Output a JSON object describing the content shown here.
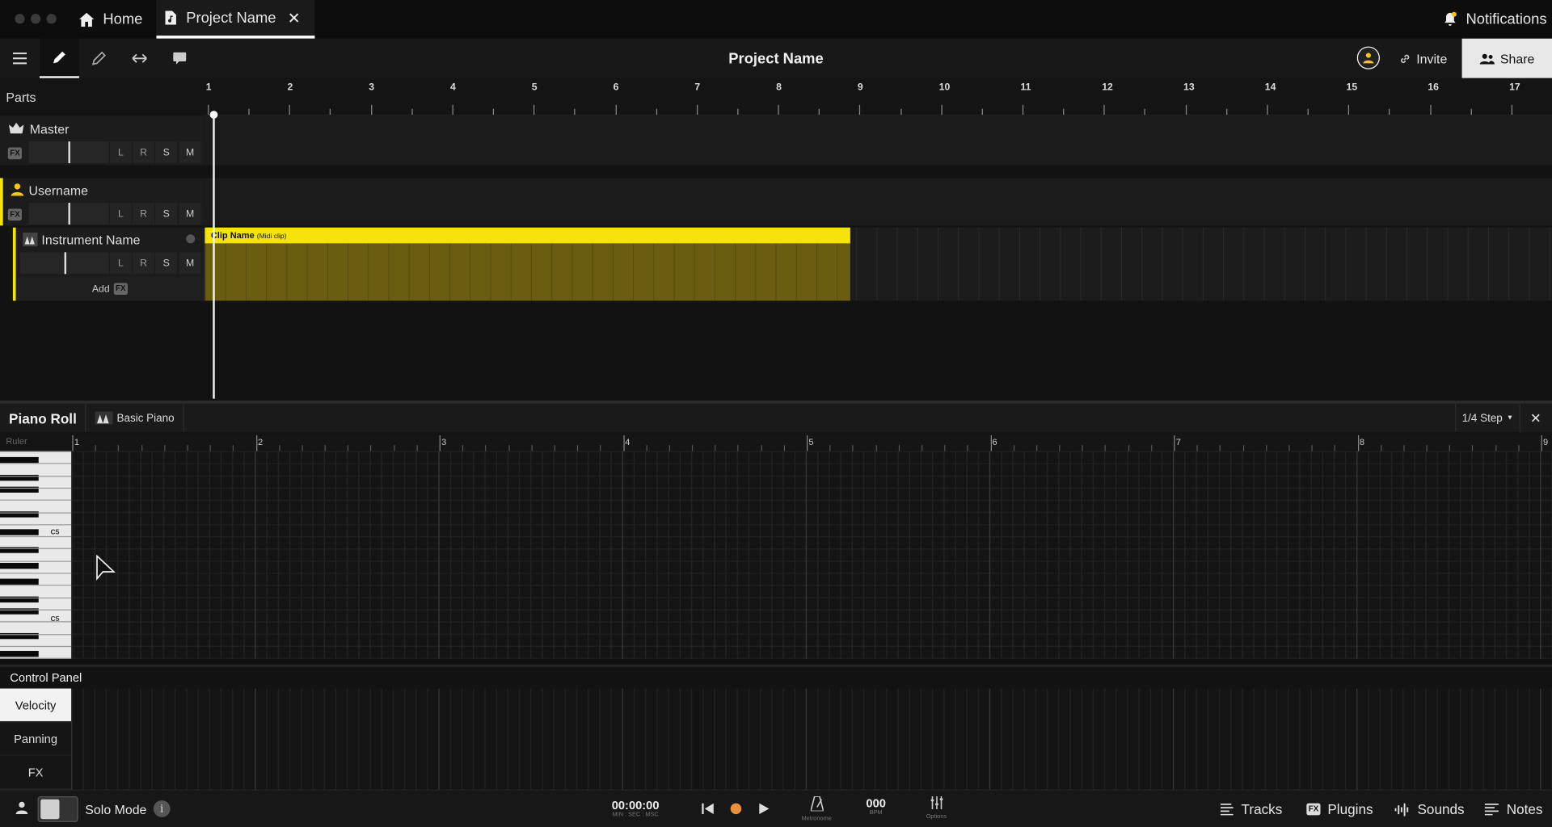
{
  "titlebar": {
    "home_label": "Home",
    "project_tab_label": "Project Name",
    "notifications_label": "Notifications"
  },
  "toolbar": {
    "title": "Project Name",
    "invite_label": "Invite",
    "share_label": "Share"
  },
  "arrangement": {
    "parts_label": "Parts",
    "bars": [
      "1",
      "2",
      "3",
      "4",
      "5",
      "6",
      "7",
      "8",
      "9",
      "10",
      "11",
      "12",
      "13",
      "14",
      "15",
      "16",
      "17"
    ],
    "tracks": {
      "master": {
        "name": "Master",
        "fx": "FX",
        "l": "L",
        "r": "R",
        "s": "S",
        "m": "M"
      },
      "user": {
        "name": "Username",
        "fx": "FX",
        "l": "L",
        "r": "R",
        "s": "S",
        "m": "M"
      },
      "instrument": {
        "name": "Instrument Name",
        "l": "L",
        "r": "R",
        "s": "S",
        "m": "M",
        "add_label": "Add",
        "fx": "FX"
      }
    },
    "clip": {
      "name": "Clip Name",
      "type": "(Midi clip)",
      "color": "#f5e30a"
    }
  },
  "piano_roll": {
    "title": "Piano Roll",
    "instrument": "Basic Piano",
    "step": "1/4 Step",
    "ruler_label": "Ruler",
    "bars": [
      "1",
      "2",
      "3",
      "4",
      "5",
      "6",
      "7",
      "8",
      "9"
    ],
    "key_labels": [
      "C5",
      "C5"
    ]
  },
  "control_panel": {
    "title": "Control Panel",
    "tabs": [
      "Velocity",
      "Panning",
      "FX"
    ]
  },
  "bottombar": {
    "solo_mode_label": "Solo Mode",
    "time": "00:00:00",
    "time_sub": "MIN : SEC : MSC",
    "metronome_label": "Metronome",
    "bpm": "000",
    "bpm_label": "BPM",
    "options_label": "Options",
    "tracks_label": "Tracks",
    "plugins_label": "Plugins",
    "sounds_label": "Sounds",
    "notes_label": "Notes"
  },
  "colors": {
    "accent": "#f5e30a",
    "record": "#e8913a"
  }
}
